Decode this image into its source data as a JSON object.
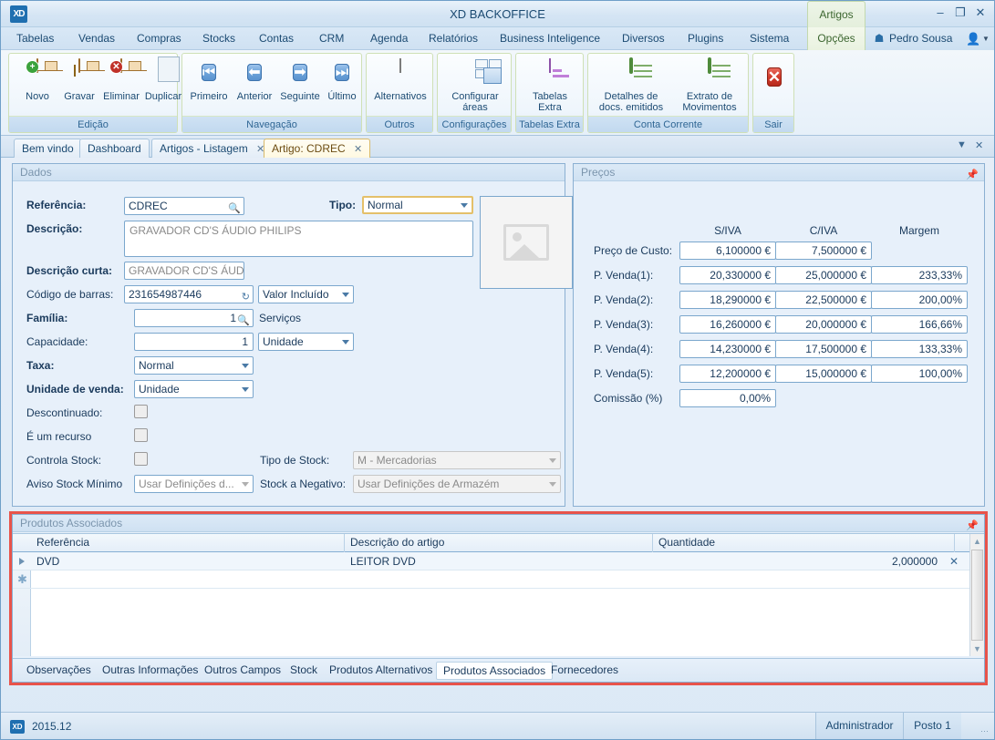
{
  "window": {
    "title": "XD BACKOFFICE",
    "logo": "XD",
    "context_tab": "Artigos",
    "minimize": "–",
    "maximize": "❐",
    "close": "✕"
  },
  "menubar": {
    "items": [
      {
        "label": "Tabelas",
        "active": false
      },
      {
        "label": "Vendas",
        "active": false
      },
      {
        "label": "Compras",
        "active": false
      },
      {
        "label": "Stocks",
        "active": false
      },
      {
        "label": "Contas",
        "active": false
      },
      {
        "label": "CRM",
        "active": false
      },
      {
        "label": "Agenda",
        "active": false
      },
      {
        "label": "Relatórios",
        "active": false
      },
      {
        "label": "Business Inteligence",
        "active": false
      },
      {
        "label": "Diversos",
        "active": false
      },
      {
        "label": "Plugins",
        "active": false
      },
      {
        "label": "Sistema",
        "active": false
      },
      {
        "label": "Opções",
        "active": true
      }
    ],
    "user": "Pedro Sousa",
    "home_icon": "home-icon",
    "avatar_icon": "user-icon",
    "caret_icon": "chevron-down-icon"
  },
  "ribbon": {
    "groups": [
      {
        "label": "Edição",
        "buttons": [
          {
            "label": "Novo",
            "icon": "new-box-icon"
          },
          {
            "label": "Gravar",
            "icon": "save-box-icon"
          },
          {
            "label": "Eliminar",
            "icon": "delete-box-icon"
          },
          {
            "label": "Duplicar",
            "icon": "duplicate-doc-icon"
          }
        ]
      },
      {
        "label": "Navegação",
        "buttons": [
          {
            "label": "Primeiro",
            "icon": "first-record-icon"
          },
          {
            "label": "Anterior",
            "icon": "previous-record-icon"
          },
          {
            "label": "Seguinte",
            "icon": "next-record-icon"
          },
          {
            "label": "Último",
            "icon": "last-record-icon"
          }
        ]
      },
      {
        "label": "Outros",
        "buttons": [
          {
            "label": "Alternativos",
            "icon": "barcode-icon"
          }
        ]
      },
      {
        "label": "Configurações",
        "buttons": [
          {
            "label": "Configurar áreas",
            "icon": "windows-layout-icon"
          }
        ]
      },
      {
        "label": "Tabelas Extra",
        "buttons": [
          {
            "label": "Tabelas Extra",
            "icon": "table-icon"
          }
        ]
      },
      {
        "label": "Conta Corrente",
        "buttons": [
          {
            "label": "Detalhes de docs. emitidos",
            "icon": "notebook-icon"
          },
          {
            "label": "Extrato de Movimentos",
            "icon": "notebook-icon"
          }
        ]
      },
      {
        "label": "Sair",
        "buttons": [
          {
            "label": "",
            "icon": "exit-x-icon"
          }
        ]
      }
    ]
  },
  "doctabs": {
    "items": [
      {
        "label": "Bem vindo",
        "closable": false,
        "active": false
      },
      {
        "label": "Dashboard",
        "closable": false,
        "active": false
      },
      {
        "label": "Artigos - Listagem",
        "closable": true,
        "active": false
      },
      {
        "label": "Artigo: CDREC",
        "closable": true,
        "active": true
      }
    ],
    "close_glyph": "✕",
    "dropdown_glyph": "▼",
    "close_all_glyph": "✕"
  },
  "dados": {
    "panel_title": "Dados",
    "pin_icon": "pin-icon",
    "fields": {
      "referencia_label": "Referência:",
      "referencia_value": "CDREC",
      "tipo_label": "Tipo:",
      "tipo_value": "Normal",
      "descricao_label": "Descrição:",
      "descricao_value": "GRAVADOR CD'S ÁUDIO PHILIPS",
      "descricao_curta_label": "Descrição curta:",
      "descricao_curta_value": "GRAVADOR CD'S ÁUDI",
      "codigo_barras_label": "Código de barras:",
      "codigo_barras_value": "231654987446",
      "valor_incluido_value": "Valor Incluído",
      "familia_label": "Família:",
      "familia_value": "1",
      "familia_name": "Serviços",
      "capacidade_label": "Capacidade:",
      "capacidade_value": "1",
      "capacidade_unit": "Unidade",
      "taxa_label": "Taxa:",
      "taxa_value": "Normal",
      "unidade_venda_label": "Unidade de venda:",
      "unidade_venda_value": "Unidade",
      "descontinuado_label": "Descontinuado:",
      "recurso_label": "É um recurso",
      "controla_stock_label": "Controla Stock:",
      "tipo_stock_label": "Tipo de Stock:",
      "tipo_stock_value": "M - Mercadorias",
      "aviso_stock_label": "Aviso Stock Mínimo",
      "aviso_stock_value": "Usar Definições d...",
      "stock_negativo_label": "Stock a Negativo:",
      "stock_negativo_value": "Usar Definições de Armazém"
    },
    "image_placeholder_icon": "image-placeholder-icon"
  },
  "precos": {
    "panel_title": "Preços",
    "pin_icon": "pin-icon",
    "columns": [
      "S/IVA",
      "C/IVA",
      "Margem"
    ],
    "rows": [
      {
        "label": "Preço de Custo:",
        "siva": "6,100000 €",
        "civa": "7,500000 €",
        "margem": null
      },
      {
        "label": "P. Venda(1):",
        "siva": "20,330000 €",
        "civa": "25,000000 €",
        "margem": "233,33%"
      },
      {
        "label": "P. Venda(2):",
        "siva": "18,290000 €",
        "civa": "22,500000 €",
        "margem": "200,00%"
      },
      {
        "label": "P. Venda(3):",
        "siva": "16,260000 €",
        "civa": "20,000000 €",
        "margem": "166,66%"
      },
      {
        "label": "P. Venda(4):",
        "siva": "14,230000 €",
        "civa": "17,500000 €",
        "margem": "133,33%"
      },
      {
        "label": "P. Venda(5):",
        "siva": "12,200000 €",
        "civa": "15,000000 €",
        "margem": "100,00%"
      }
    ],
    "comissao_label": "Comissão (%)",
    "comissao_value": "0,00%"
  },
  "associados": {
    "panel_title": "Produtos Associados",
    "pin_icon": "pin-icon",
    "columns": [
      "Referência",
      "Descrição do artigo",
      "Quantidade"
    ],
    "rows": [
      {
        "referencia": "DVD",
        "descricao": "LEITOR DVD",
        "quantidade": "2,000000",
        "delete_glyph": "✕"
      }
    ],
    "new_row_glyph": "✱",
    "scroll_up_glyph": "▲",
    "scroll_down_glyph": "▼",
    "tabs": [
      {
        "label": "Observações",
        "active": false
      },
      {
        "label": "Outras Informações",
        "active": false
      },
      {
        "label": "Outros Campos",
        "active": false
      },
      {
        "label": "Stock",
        "active": false
      },
      {
        "label": "Produtos Alternativos",
        "active": false
      },
      {
        "label": "Produtos Associados",
        "active": true
      },
      {
        "label": "Fornecedores",
        "active": false
      }
    ]
  },
  "statusbar": {
    "logo": "XD",
    "version": "2015.12",
    "user": "Administrador",
    "post": "Posto 1",
    "grip_icon": "resize-grip-icon"
  },
  "colors": {
    "accent": "#1f6fb0",
    "highlight_border": "#e8534a",
    "panel_bg": "#e7f0fa",
    "active_tab": "#fff9e2"
  }
}
